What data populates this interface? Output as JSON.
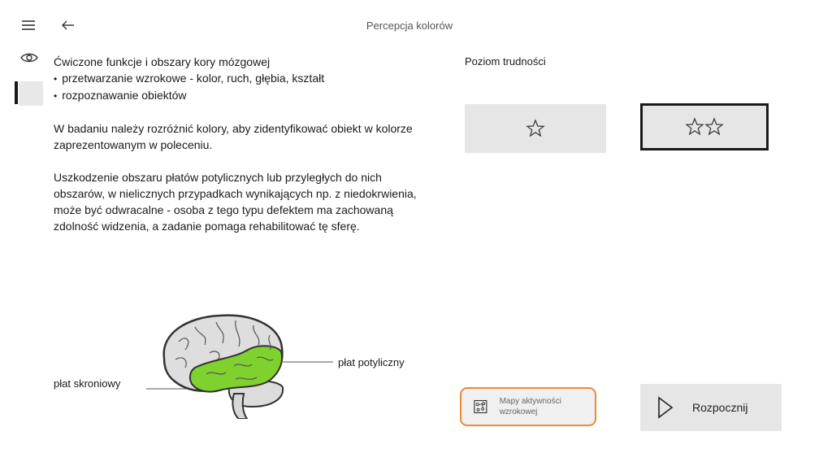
{
  "header": {
    "title": "Percepcja kolorów"
  },
  "description": {
    "heading": "Ćwiczone funkcje i obszary kory mózgowej",
    "bullets": [
      "przetwarzanie wzrokowe - kolor, ruch, głębia, kształt",
      "rozpoznawanie obiektów"
    ],
    "paragraph1": "W badaniu należy rozróżnić kolory, aby zidentyfikować obiekt w kolorze zaprezentowanym w poleceniu.",
    "paragraph2": "Uszkodzenie obszaru płatów potylicznych lub przyległych do nich obszarów, w nielicznych przypadkach wynikających np. z niedokrwienia, może być odwracalne - osoba z tego typu defektem ma zachowaną zdolność widzenia, a zadanie pomaga rehabilitować tę sferę."
  },
  "illustration": {
    "label_temporal": "płat skroniowy",
    "label_occipital": "płat potyliczny",
    "highlight_color": "#7fd12d"
  },
  "difficulty": {
    "label": "Poziom trudności",
    "levels": [
      {
        "stars": 1,
        "selected": false
      },
      {
        "stars": 2,
        "selected": true
      }
    ]
  },
  "actions": {
    "map_label": "Mapy aktywności wzrokowej",
    "start_label": "Rozpocznij",
    "map_border_color": "#f08a34"
  },
  "icons": {
    "menu": "hamburger-icon",
    "back": "arrow-left-icon",
    "eye": "eye-icon",
    "star": "star-outline-icon",
    "map": "map-icon",
    "play": "play-icon"
  }
}
